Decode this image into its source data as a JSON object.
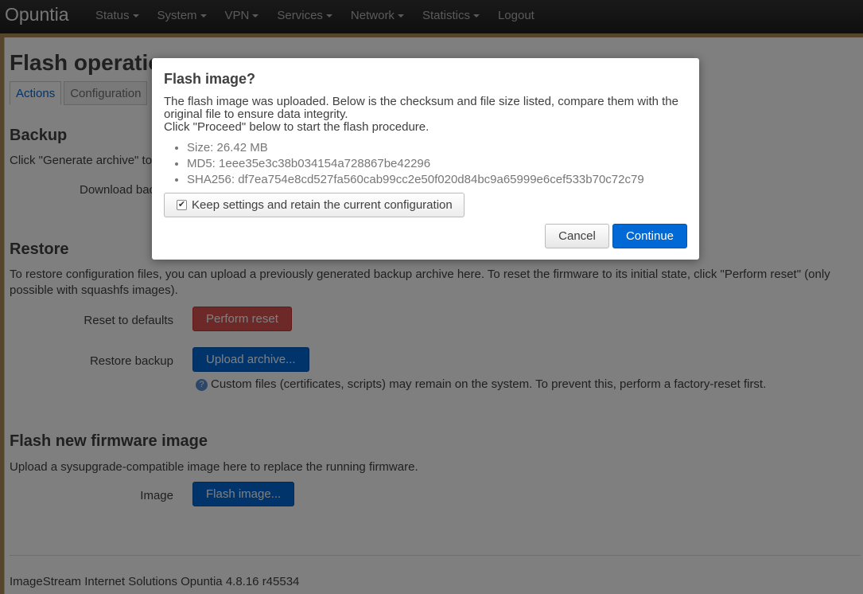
{
  "navbar": {
    "brand": "Opuntia",
    "items": [
      {
        "label": "Status",
        "dropdown": true
      },
      {
        "label": "System",
        "dropdown": true
      },
      {
        "label": "VPN",
        "dropdown": true
      },
      {
        "label": "Services",
        "dropdown": true
      },
      {
        "label": "Network",
        "dropdown": true
      },
      {
        "label": "Statistics",
        "dropdown": true
      },
      {
        "label": "Logout",
        "dropdown": false
      }
    ]
  },
  "page": {
    "title": "Flash operations",
    "tabs": [
      {
        "label": "Actions",
        "active": true
      },
      {
        "label": "Configuration",
        "active": false
      }
    ],
    "backup": {
      "title": "Backup",
      "description": "Click \"Generate archive\" to",
      "download_label": "Download bac"
    },
    "restore": {
      "title": "Restore",
      "description": "To restore configuration files, you can upload a previously generated backup archive here. To reset the firmware to its initial state, click \"Perform reset\" (only possible with squashfs images).",
      "reset_label": "Reset to defaults",
      "reset_button": "Perform reset",
      "restore_label": "Restore backup",
      "upload_button": "Upload archive...",
      "hint": "Custom files (certificates, scripts) may remain on the system. To prevent this, perform a factory-reset first."
    },
    "flash": {
      "title": "Flash new firmware image",
      "description": "Upload a sysupgrade-compatible image here to replace the running firmware.",
      "image_label": "Image",
      "flash_button": "Flash image..."
    },
    "footer": "ImageStream Internet Solutions Opuntia 4.8.16 r45534"
  },
  "modal": {
    "title": "Flash image?",
    "text1": "The flash image was uploaded. Below is the checksum and file size listed, compare them with the original file to ensure data integrity.",
    "text2": "Click \"Proceed\" below to start the flash procedure.",
    "details": [
      "Size: 26.42 MB",
      "MD5: 1eee35e3c38b034154a728867be42296",
      "SHA256: df7ea754e8cd527fa560cab99cc2e50f020d84bc9a65999e6cef533b70c72c79"
    ],
    "keep_settings_label": "Keep settings and retain the current configuration",
    "keep_settings_checked": true,
    "cancel_label": "Cancel",
    "continue_label": "Continue"
  },
  "colors": {
    "primary": "#0069d6",
    "danger": "#d9534f",
    "navbar": "#222222"
  }
}
